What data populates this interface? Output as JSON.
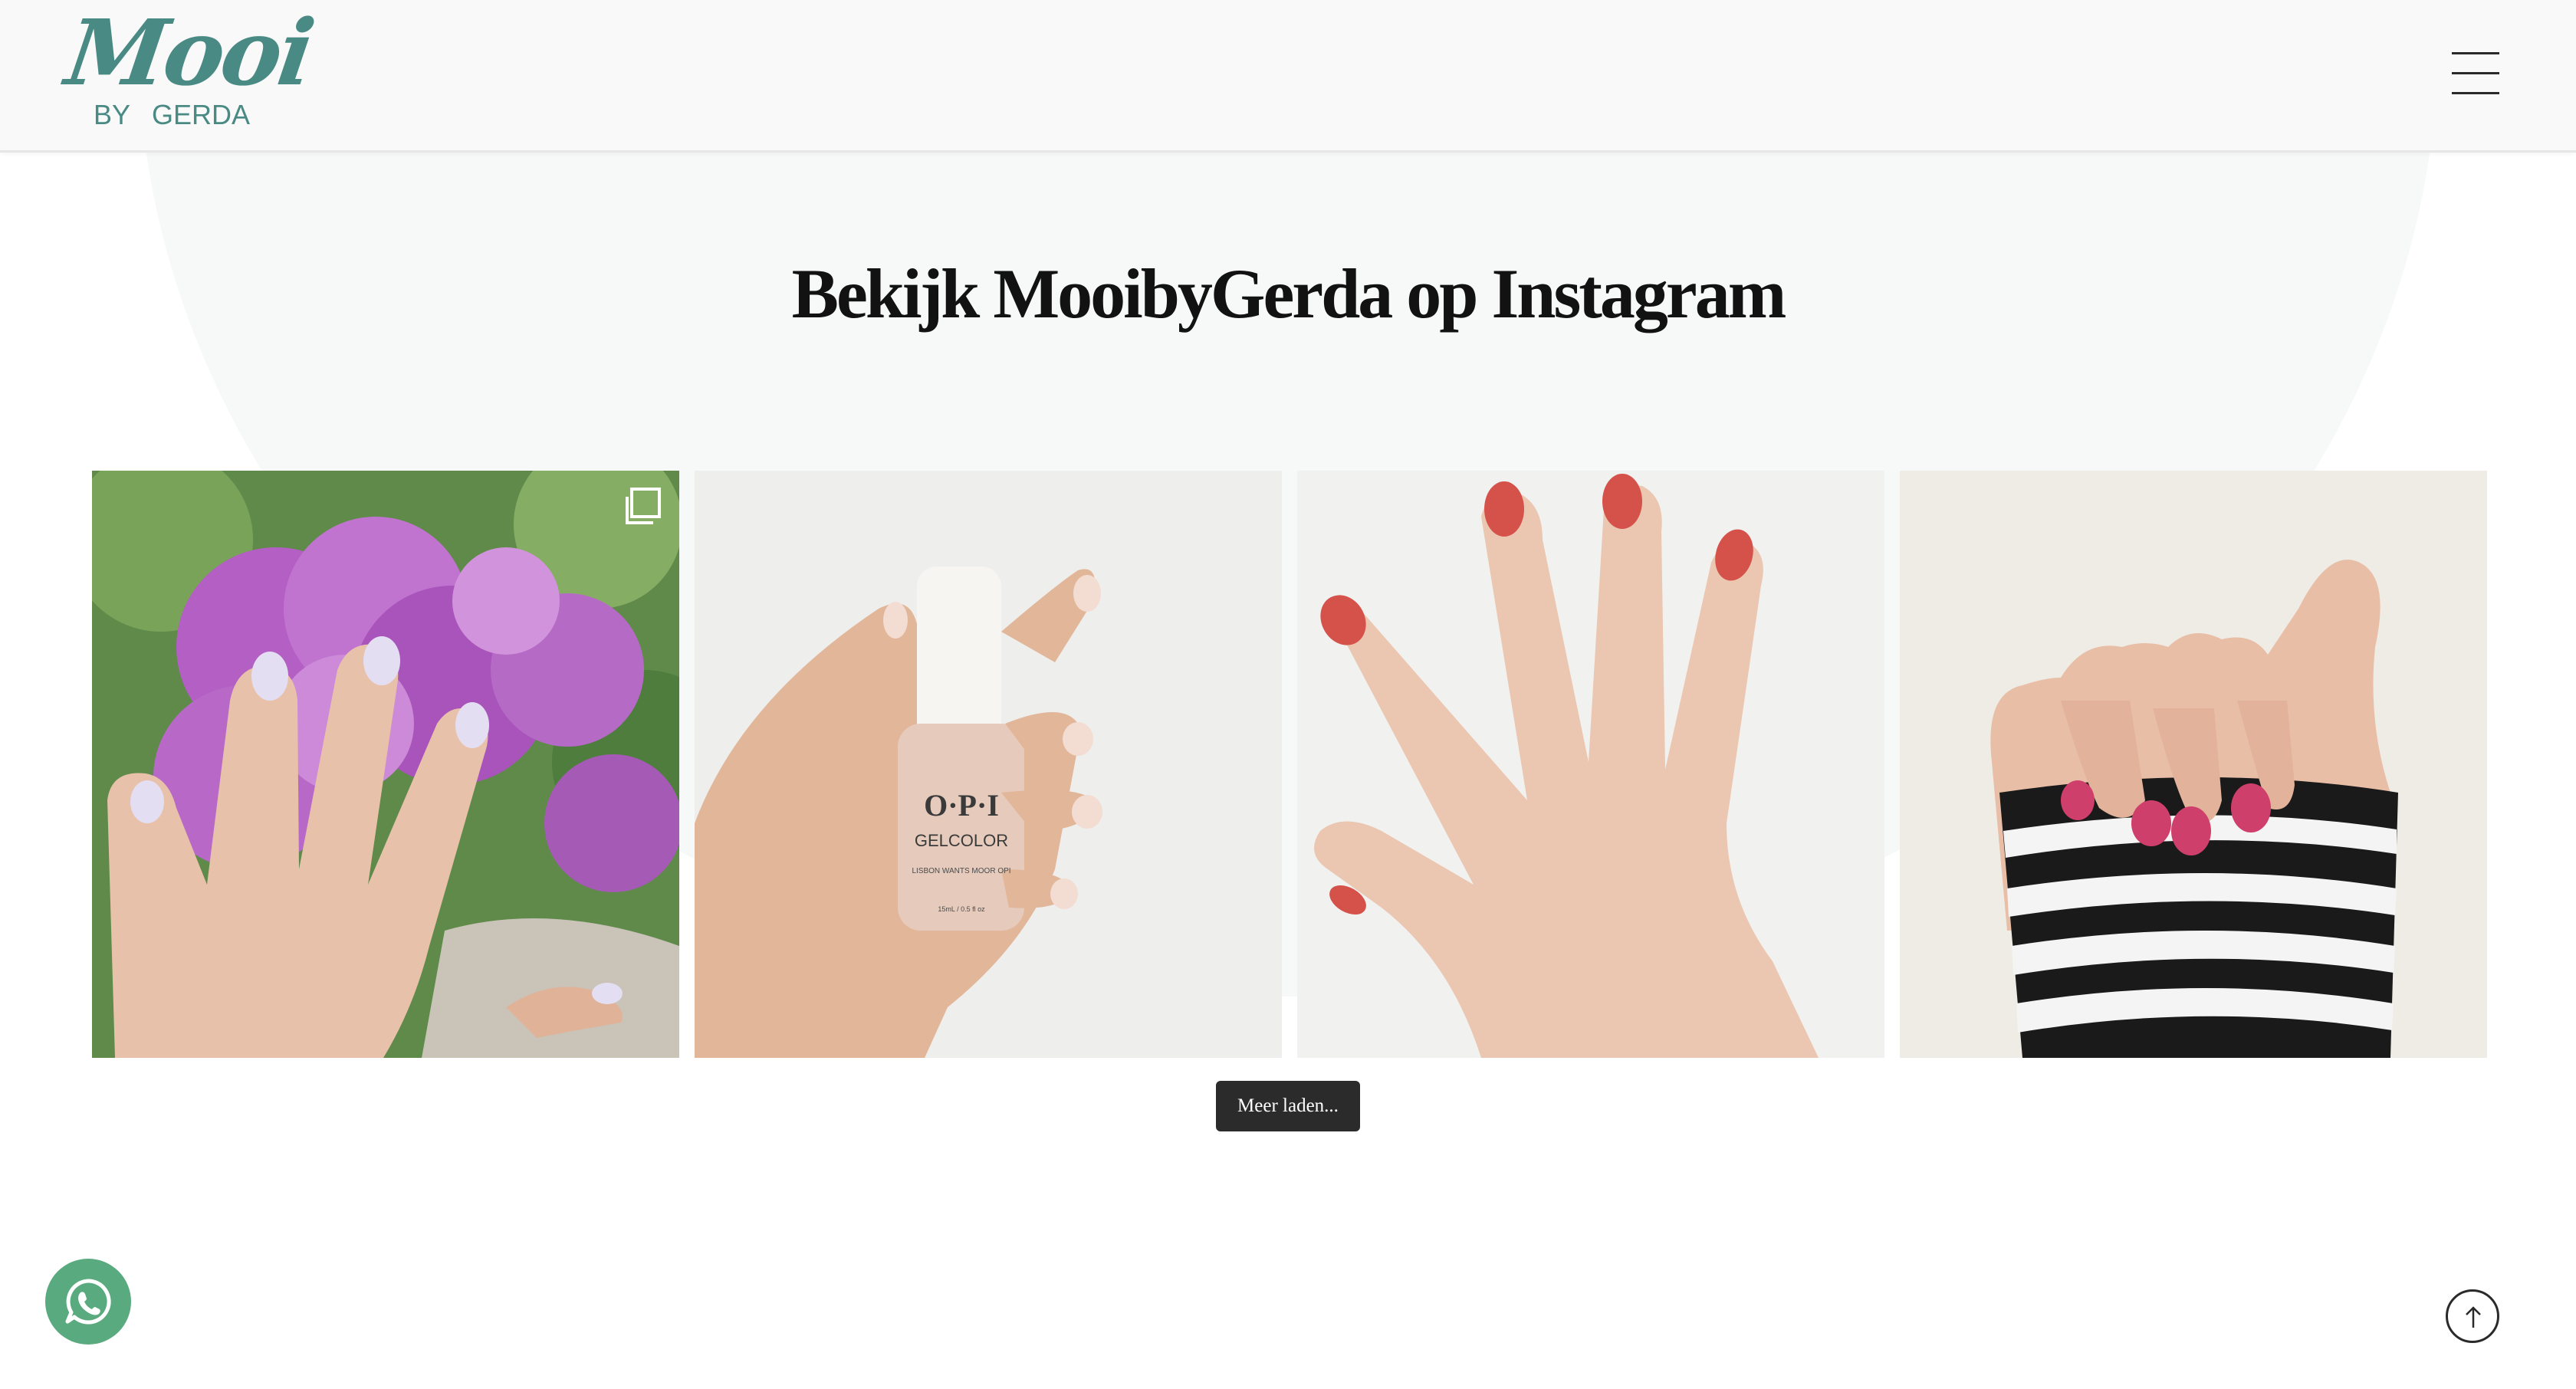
{
  "header": {
    "logo": {
      "script_text": "Mooi",
      "by_text": "BY",
      "name_text": "GERDA"
    },
    "menu_icon": "hamburger-menu-icon"
  },
  "instagram": {
    "title": "Bekijk MooibyGerda op Instagram",
    "posts": [
      {
        "subject": "hand with pale lilac nails against pink hydrangea",
        "carousel": true,
        "icon": "carousel-icon"
      },
      {
        "subject": "hand holding OPI Gelcolor bottle",
        "bottle_brand": "O·P·I",
        "bottle_line": "GELCOLOR",
        "bottle_shade": "LISBON WANTS MOOR OPI",
        "bottle_size": "15mL / 0.5 fl oz"
      },
      {
        "subject": "hand with coral red nails on white wall"
      },
      {
        "subject": "hand with pink nails and striped sleeve"
      }
    ],
    "load_more_label": "Meer laden..."
  },
  "floating": {
    "whatsapp_icon": "whatsapp-icon",
    "scroll_top_icon": "arrow-up-icon"
  },
  "colors": {
    "brand_teal": "#4a8a84",
    "whatsapp_green": "#5aaa7f",
    "button_dark": "#2b2b2b"
  }
}
